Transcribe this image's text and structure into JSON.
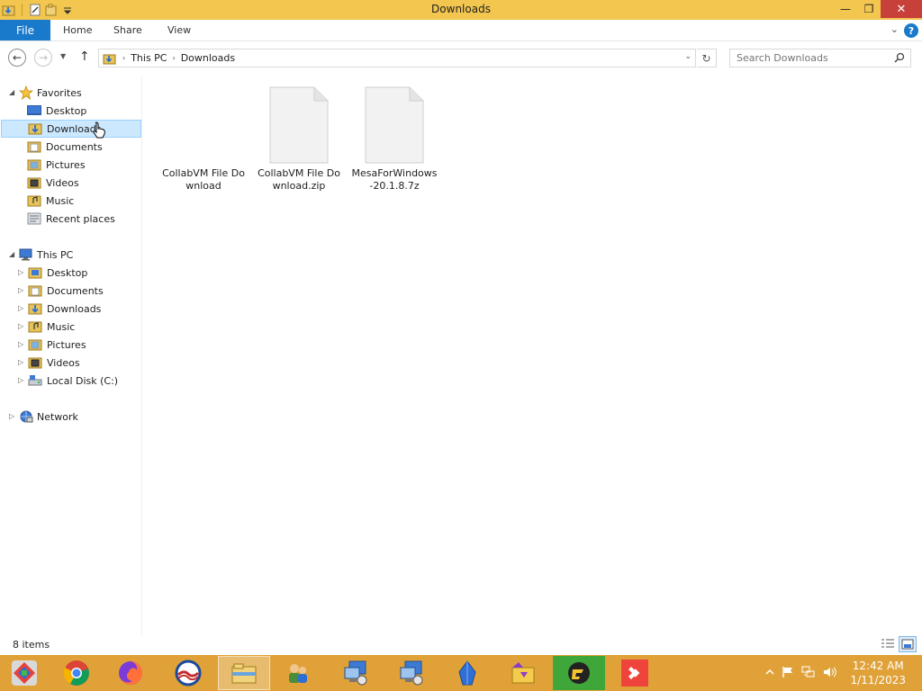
{
  "window": {
    "title": "Downloads",
    "controls": {
      "minimize": "—",
      "maximize": "❐",
      "close": "✕"
    }
  },
  "ribbon": {
    "file_tab": "File",
    "tabs": [
      {
        "label": "Home"
      },
      {
        "label": "Share"
      },
      {
        "label": "View"
      }
    ],
    "help_glyph": "?",
    "expand_glyph": "⌄"
  },
  "nav": {
    "back_glyph": "←",
    "forward_glyph": "→",
    "recent_glyph": "▼",
    "up_glyph": "↑",
    "refresh_glyph": "↻"
  },
  "address": {
    "crumbs": [
      "This PC",
      "Downloads"
    ],
    "separator": "›",
    "dropdown_glyph": "⌄"
  },
  "search": {
    "placeholder": "Search Downloads",
    "icon": "search-icon"
  },
  "sidebar": {
    "favorites": {
      "label": "Favorites",
      "items": [
        {
          "label": "Desktop",
          "icon": "desktop-icon"
        },
        {
          "label": "Downloads",
          "icon": "downloads-folder-icon",
          "selected": true
        },
        {
          "label": "Documents",
          "icon": "documents-folder-icon"
        },
        {
          "label": "Pictures",
          "icon": "pictures-folder-icon"
        },
        {
          "label": "Videos",
          "icon": "videos-folder-icon"
        },
        {
          "label": "Music",
          "icon": "music-folder-icon"
        },
        {
          "label": "Recent places",
          "icon": "recent-places-icon"
        }
      ]
    },
    "this_pc": {
      "label": "This PC",
      "items": [
        {
          "label": "Desktop",
          "icon": "desktop-folder-icon"
        },
        {
          "label": "Documents",
          "icon": "documents-folder-icon"
        },
        {
          "label": "Downloads",
          "icon": "downloads-folder-icon"
        },
        {
          "label": "Music",
          "icon": "music-folder-icon"
        },
        {
          "label": "Pictures",
          "icon": "pictures-folder-icon"
        },
        {
          "label": "Videos",
          "icon": "videos-folder-icon"
        },
        {
          "label": "Local Disk (C:)",
          "icon": "local-disk-icon"
        }
      ]
    },
    "network": {
      "label": "Network",
      "icon": "network-icon"
    }
  },
  "files": [
    {
      "name": "CollabVM File Download"
    },
    {
      "name": "CollabVM File Download.zip"
    },
    {
      "name": "MesaForWindows-20.1.8.7z"
    }
  ],
  "status": {
    "item_count": "8 items"
  },
  "taskbar": {
    "apps": [
      {
        "name": "start-icon"
      },
      {
        "name": "chrome-icon"
      },
      {
        "name": "firefox-icon"
      },
      {
        "name": "opera-icon"
      },
      {
        "name": "file-explorer-icon",
        "active": true
      },
      {
        "name": "users-icon"
      },
      {
        "name": "remote-desktop-icon"
      },
      {
        "name": "remote-desktop-icon-2"
      },
      {
        "name": "blue-crystal-icon"
      },
      {
        "name": "yellow-folder-app-icon"
      },
      {
        "name": "game-launcher-icon"
      },
      {
        "name": "anydesk-icon"
      }
    ],
    "tray": {
      "time": "12:42 AM",
      "date": "1/11/2023"
    }
  },
  "colors": {
    "titlebar": "#f3c64f",
    "taskbar": "#e0a238",
    "file_tab": "#1979ca",
    "selection": "#cce8ff",
    "close": "#c7403a"
  }
}
